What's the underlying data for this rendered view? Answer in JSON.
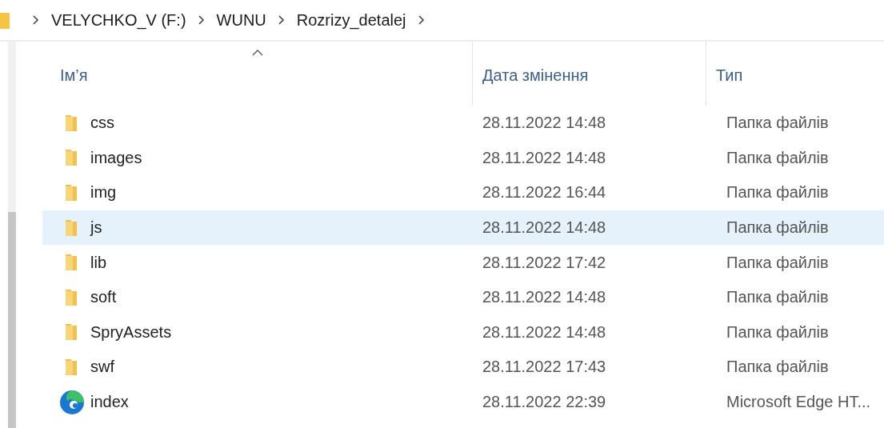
{
  "breadcrumb": [
    "VELYCHKO_V (F:)",
    "WUNU",
    "Rozrizy_detalej"
  ],
  "table": {
    "columns": [
      {
        "label": "Ім’я",
        "sorted": true
      },
      {
        "label": "Дата змінення",
        "sorted": false
      },
      {
        "label": "Тип",
        "sorted": false
      }
    ],
    "rows": [
      {
        "kind": "folder",
        "name": "css",
        "date": "28.11.2022 14:48",
        "type": "Папка файлів",
        "selected": false
      },
      {
        "kind": "folder",
        "name": "images",
        "date": "28.11.2022 14:48",
        "type": "Папка файлів",
        "selected": false
      },
      {
        "kind": "folder",
        "name": "img",
        "date": "28.11.2022 16:44",
        "type": "Папка файлів",
        "selected": false
      },
      {
        "kind": "folder",
        "name": "js",
        "date": "28.11.2022 14:48",
        "type": "Папка файлів",
        "selected": true
      },
      {
        "kind": "folder",
        "name": "lib",
        "date": "28.11.2022 17:42",
        "type": "Папка файлів",
        "selected": false
      },
      {
        "kind": "folder",
        "name": "soft",
        "date": "28.11.2022 14:48",
        "type": "Папка файлів",
        "selected": false
      },
      {
        "kind": "folder",
        "name": "SpryAssets",
        "date": "28.11.2022 14:48",
        "type": "Папка файлів",
        "selected": false
      },
      {
        "kind": "folder",
        "name": "swf",
        "date": "28.11.2022 17:43",
        "type": "Папка файлів",
        "selected": false
      },
      {
        "kind": "edge",
        "name": "index",
        "date": "28.11.2022 22:39",
        "type": "Microsoft Edge HT...",
        "selected": false
      }
    ]
  }
}
